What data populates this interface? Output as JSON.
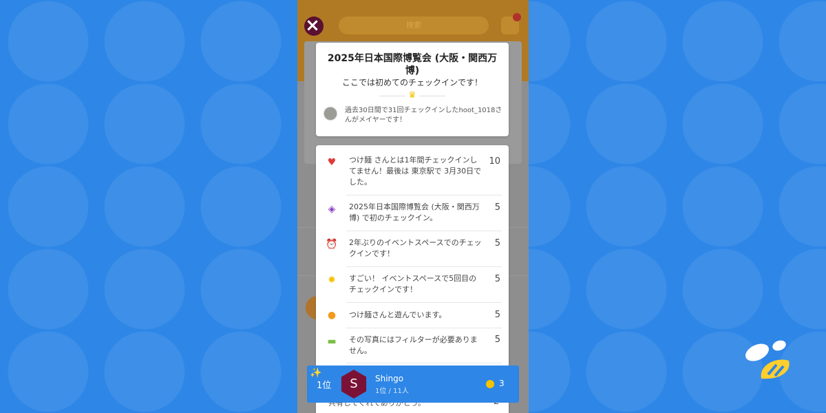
{
  "background": {
    "color": "#2e86e6"
  },
  "topbar": {
    "search_placeholder": "検索",
    "close_label": "×"
  },
  "venue_card": {
    "title": "2025年日本国際博覧会 (大阪・関西万博)",
    "subtitle": "ここでは初めてのチェックインです！",
    "mayor_text": "過去30日間で31回チェックインしたhoot_1018さんがメイヤーです！"
  },
  "bonus_items": [
    {
      "icon": "heart-icon",
      "color": "#e03a3a",
      "text": "つけ麺 さんとは1年間チェックインしてません！最後は 東京駅で 3月30日でした。",
      "points": "10"
    },
    {
      "icon": "compass-icon",
      "color": "#8a3fc2",
      "text": "2025年日本国際博覧会 (大阪・関西万博) で初のチェックイン。",
      "points": "5"
    },
    {
      "icon": "alarm-clock-icon",
      "color": "#e03a3a",
      "text": "2年ぶりのイベントスペースでのチェックインです！",
      "points": "5"
    },
    {
      "icon": "star-badge-icon",
      "color": "#f2c200",
      "text": "すごい！ イベントスペースで5回目のチェックインです！",
      "points": "5"
    },
    {
      "icon": "friend-face-icon",
      "color": "#f39a1d",
      "text": "つけ麺さんと遊んでいます。",
      "points": "5"
    },
    {
      "icon": "photo-icon",
      "color": "#7bc043",
      "text": "その写真にはフィルターが必要ありません。",
      "points": "5"
    }
  ],
  "below_item": {
    "text": "共有してくれてありがとう。",
    "points": "2"
  },
  "leaderboard": {
    "rank": "1位",
    "avatar_initial": "S",
    "name": "Shingo",
    "sub": "1位 / 11人",
    "coins": "3"
  }
}
